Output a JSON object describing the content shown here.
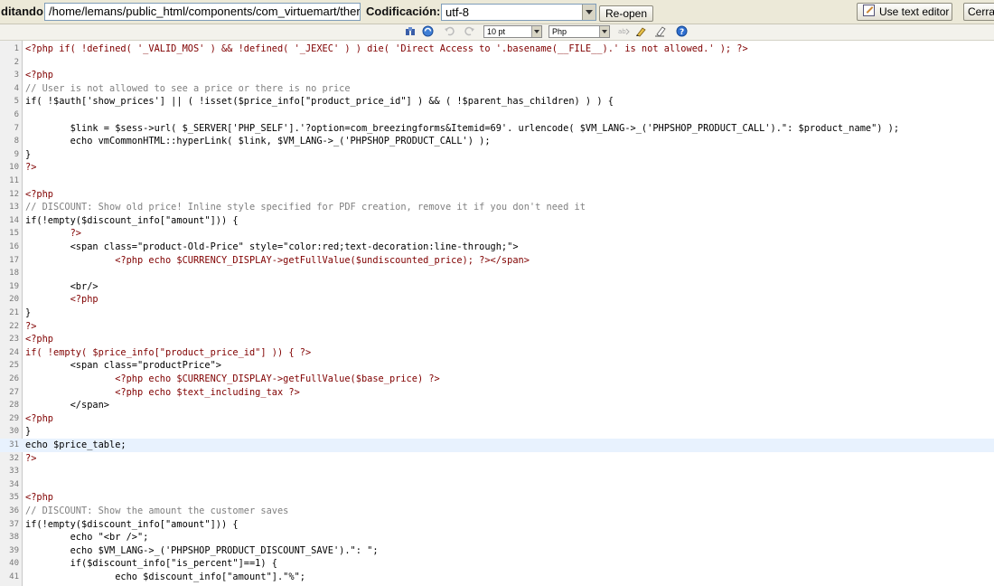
{
  "topbar": {
    "editing_label": "ditando:",
    "file_path": "/home/lemans/public_html/components/com_virtuemart/ther",
    "encoding_label": "Codificación:",
    "encoding_value": "utf-8",
    "reopen_label": "Re-open",
    "text_editor_label": "Use text editor",
    "close_label": "Cerra"
  },
  "toolbar": {
    "font_size": "10 pt",
    "syntax": "Php",
    "icons": [
      "search-icon",
      "replace-icon",
      "undo-icon",
      "redo-icon",
      "word-wrap-icon",
      "highlight-icon",
      "reset-icon",
      "help-icon"
    ]
  },
  "editor": {
    "active_line": 31,
    "lines": [
      {
        "n": "1",
        "code": "<?php if( !defined( '_VALID_MOS' ) && !defined( '_JEXEC' ) ) die( 'Direct Access to '.basename(__FILE__).' is not allowed.' ); ?>"
      },
      {
        "n": "2",
        "code": ""
      },
      {
        "n": "3",
        "code": "<?php"
      },
      {
        "n": "4",
        "code": "// User is not allowed to see a price or there is no price"
      },
      {
        "n": "5",
        "code": "if( !$auth['show_prices'] || ( !isset($price_info[\"product_price_id\"] ) && ( !$parent_has_children) ) ) {"
      },
      {
        "n": "6",
        "code": ""
      },
      {
        "n": "7",
        "code": "        $link = $sess->url( $_SERVER['PHP_SELF'].'?option=com_breezingforms&Itemid=69'. urlencode( $VM_LANG->_('PHPSHOP_PRODUCT_CALL').\": $product_name\") );"
      },
      {
        "n": "8",
        "code": "        echo vmCommonHTML::hyperLink( $link, $VM_LANG->_('PHPSHOP_PRODUCT_CALL') );"
      },
      {
        "n": "9",
        "code": "}"
      },
      {
        "n": "10",
        "code": "?>"
      },
      {
        "n": "11",
        "code": ""
      },
      {
        "n": "12",
        "code": "<?php"
      },
      {
        "n": "13",
        "code": "// DISCOUNT: Show old price! Inline style specified for PDF creation, remove it if you don't need it"
      },
      {
        "n": "14",
        "code": "if(!empty($discount_info[\"amount\"])) {"
      },
      {
        "n": "15",
        "code": "        ?>"
      },
      {
        "n": "16",
        "code": "        <span class=\"product-Old-Price\" style=\"color:red;text-decoration:line-through;\">"
      },
      {
        "n": "17",
        "code": "                <?php echo $CURRENCY_DISPLAY->getFullValue($undiscounted_price); ?></span>"
      },
      {
        "n": "18",
        "code": ""
      },
      {
        "n": "19",
        "code": "        <br/>"
      },
      {
        "n": "20",
        "code": "        <?php"
      },
      {
        "n": "21",
        "code": "}"
      },
      {
        "n": "22",
        "code": "?>"
      },
      {
        "n": "23",
        "code": "<?php"
      },
      {
        "n": "24",
        "code": "if( !empty( $price_info[\"product_price_id\"] )) { ?>"
      },
      {
        "n": "25",
        "code": "        <span class=\"productPrice\">"
      },
      {
        "n": "26",
        "code": "                <?php echo $CURRENCY_DISPLAY->getFullValue($base_price) ?>"
      },
      {
        "n": "27",
        "code": "                <?php echo $text_including_tax ?>"
      },
      {
        "n": "28",
        "code": "        </span>"
      },
      {
        "n": "29",
        "code": "<?php"
      },
      {
        "n": "30",
        "code": "}"
      },
      {
        "n": "31",
        "code": "echo $price_table;"
      },
      {
        "n": "32",
        "code": "?>"
      },
      {
        "n": "33",
        "code": ""
      },
      {
        "n": "34",
        "code": ""
      },
      {
        "n": "35",
        "code": "<?php"
      },
      {
        "n": "36",
        "code": "// DISCOUNT: Show the amount the customer saves"
      },
      {
        "n": "37",
        "code": "if(!empty($discount_info[\"amount\"])) {"
      },
      {
        "n": "38",
        "code": "        echo \"<br />\";"
      },
      {
        "n": "39",
        "code": "        echo $VM_LANG->_('PHPSHOP_PRODUCT_DISCOUNT_SAVE').\": \";"
      },
      {
        "n": "40",
        "code": "        if($discount_info[\"is_percent\"]==1) {"
      },
      {
        "n": "41",
        "code": "                echo $discount_info[\"amount\"].\"%\";"
      }
    ]
  }
}
